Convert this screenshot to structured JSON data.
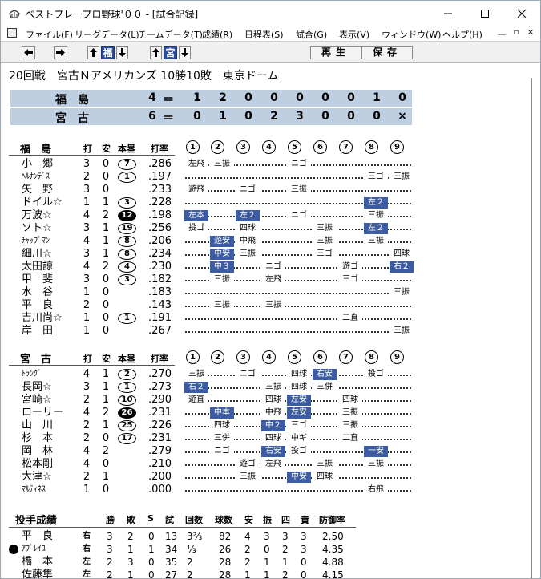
{
  "window": {
    "title": "ベストプレープロ野球'００ - [試合記録]"
  },
  "menu": [
    "ファイル(F)",
    "リーグデータ(L)",
    "チームデータ(T)",
    "成績(R)",
    "日程表(S)",
    "試合(G)",
    "表示(V)",
    "ウィンドウ(W)",
    "ヘルプ(H)"
  ],
  "toolbar": {
    "team1": "福",
    "team2": "宮",
    "play": "再生",
    "save": "保存"
  },
  "game": {
    "title": "20回戦　宮古Ｎアメリカンズ  10勝10敗　東京ドーム"
  },
  "scoreboard": [
    {
      "team": "福　島",
      "runs": "4",
      "eq": "＝",
      "innings": [
        "1",
        "2",
        "0",
        "0",
        "0",
        "0",
        "0",
        "1",
        "0"
      ]
    },
    {
      "team": "宮　古",
      "runs": "6",
      "eq": "＝",
      "innings": [
        "0",
        "1",
        "0",
        "2",
        "3",
        "0",
        "0",
        "0",
        "×"
      ]
    }
  ],
  "headers": {
    "ab": "打",
    "h": "安",
    "hr": "本塁",
    "avg": "打率",
    "innings": [
      "①",
      "②",
      "③",
      "④",
      "⑤",
      "⑥",
      "⑦",
      "⑧",
      "⑨"
    ]
  },
  "chart_data": {
    "type": "table",
    "teams": [
      {
        "name": "福　島",
        "batters": [
          {
            "name": "小　郷",
            "ab": "3",
            "h": "0",
            "hr": "7",
            "avg": ".286",
            "results": [
              [
                1,
                "左飛"
              ],
              [
                2,
                "三振"
              ],
              [
                5,
                "ニゴ"
              ]
            ]
          },
          {
            "name": "ﾍﾙﾅﾝﾃﾞｽ",
            "narrow": true,
            "ab": "2",
            "h": "0",
            "hr": "1",
            "avg": ".197",
            "results": [
              [
                8,
                "三ゴ"
              ],
              [
                9,
                "三振"
              ]
            ]
          },
          {
            "name": "矢　野",
            "ab": "3",
            "h": "0",
            "avg": ".233",
            "results": [
              [
                1,
                "遊飛"
              ],
              [
                3,
                "ニゴ"
              ],
              [
                5,
                "三振"
              ]
            ]
          },
          {
            "name": "ドイル☆",
            "ab": "1",
            "h": "1",
            "hr": "3",
            "avg": ".228",
            "results": [
              [
                8,
                "左２",
                1
              ]
            ]
          },
          {
            "name": "万波☆",
            "ab": "4",
            "h": "2",
            "hr": "12",
            "hrfill": true,
            "avg": ".198",
            "results": [
              [
                1,
                "左本",
                1
              ],
              [
                3,
                "左２",
                1
              ],
              [
                5,
                "ニゴ"
              ],
              [
                8,
                "三振"
              ]
            ]
          },
          {
            "name": "ソト☆",
            "ab": "3",
            "h": "1",
            "hr": "19",
            "avg": ".256",
            "results": [
              [
                1,
                "投ゴ"
              ],
              [
                3,
                "四球"
              ],
              [
                6,
                "三振"
              ],
              [
                8,
                "左２",
                1
              ]
            ]
          },
          {
            "name": "ﾁｬｯﾌﾟﾏﾝ",
            "narrow": true,
            "ab": "4",
            "h": "1",
            "hr": "8",
            "avg": ".206",
            "results": [
              [
                2,
                "遊安",
                1
              ],
              [
                3,
                "中飛"
              ],
              [
                6,
                "三振"
              ],
              [
                8,
                "三振"
              ]
            ]
          },
          {
            "name": "細川☆",
            "ab": "3",
            "h": "1",
            "hr": "8",
            "avg": ".234",
            "results": [
              [
                2,
                "中安",
                1
              ],
              [
                3,
                "三振"
              ],
              [
                6,
                "三ゴ"
              ],
              [
                9,
                "四球"
              ]
            ]
          },
          {
            "name": "太田諒",
            "ab": "4",
            "h": "2",
            "hr": "4",
            "avg": ".230",
            "results": [
              [
                2,
                "中３",
                1
              ],
              [
                4,
                "ニゴ"
              ],
              [
                7,
                "遊ゴ"
              ],
              [
                9,
                "右２",
                1
              ]
            ]
          },
          {
            "name": "甲　斐",
            "ab": "3",
            "h": "0",
            "hr": "3",
            "avg": ".182",
            "results": [
              [
                2,
                "三振"
              ],
              [
                4,
                "左飛"
              ],
              [
                7,
                "三ゴ"
              ]
            ]
          },
          {
            "name": "水　谷",
            "ab": "1",
            "h": "0",
            "avg": ".183",
            "results": [
              [
                9,
                "三振"
              ]
            ]
          },
          {
            "name": "平　良",
            "ab": "2",
            "h": "0",
            "avg": ".143",
            "results": [
              [
                2,
                "三振"
              ],
              [
                4,
                "三振"
              ]
            ]
          },
          {
            "name": "吉川尚☆",
            "ab": "1",
            "h": "0",
            "hr": "1",
            "avg": ".191",
            "results": [
              [
                7,
                "二直"
              ]
            ]
          },
          {
            "name": "岸　田",
            "ab": "1",
            "h": "0",
            "avg": ".267",
            "results": [
              [
                9,
                "三振"
              ]
            ]
          }
        ]
      },
      {
        "name": "宮　古",
        "batters": [
          {
            "name": "ﾄﾗﾝｸﾞ",
            "narrow": true,
            "ab": "4",
            "h": "1",
            "hr": "2",
            "avg": ".270",
            "results": [
              [
                1,
                "三振"
              ],
              [
                3,
                "ニゴ"
              ],
              [
                5,
                "四球"
              ],
              [
                6,
                "右安",
                1
              ],
              [
                8,
                "投ゴ"
              ]
            ]
          },
          {
            "name": "長岡☆",
            "ab": "3",
            "h": "1",
            "hr": "1",
            "avg": ".273",
            "results": [
              [
                1,
                "右２",
                1
              ],
              [
                4,
                "三振"
              ],
              [
                5,
                "四球"
              ],
              [
                6,
                "三併"
              ]
            ]
          },
          {
            "name": "宮崎☆",
            "ab": "2",
            "h": "1",
            "hr": "10",
            "avg": ".290",
            "results": [
              [
                1,
                "遊直"
              ],
              [
                4,
                "四球"
              ],
              [
                5,
                "左安",
                1
              ],
              [
                7,
                "四球"
              ]
            ]
          },
          {
            "name": "ローリー",
            "ab": "4",
            "h": "2",
            "hr": "26",
            "hrfill": true,
            "avg": ".231",
            "results": [
              [
                2,
                "中本",
                1
              ],
              [
                4,
                "中飛"
              ],
              [
                5,
                "左安",
                1
              ],
              [
                7,
                "三振"
              ]
            ]
          },
          {
            "name": "山　川",
            "ab": "2",
            "h": "1",
            "hr": "25",
            "avg": ".226",
            "results": [
              [
                2,
                "四球"
              ],
              [
                4,
                "中２",
                1
              ],
              [
                5,
                "三ゴ"
              ],
              [
                7,
                "三振"
              ]
            ]
          },
          {
            "name": "杉　本",
            "ab": "2",
            "h": "0",
            "hr": "17",
            "avg": ".231",
            "results": [
              [
                2,
                "三併"
              ],
              [
                4,
                "四球"
              ],
              [
                5,
                "中ギ"
              ],
              [
                7,
                "二直"
              ]
            ]
          },
          {
            "name": "岡　林",
            "ab": "4",
            "h": "2",
            "avg": ".279",
            "results": [
              [
                2,
                "ニゴ"
              ],
              [
                4,
                "右安",
                1
              ],
              [
                5,
                "投ゴ"
              ],
              [
                8,
                "一安",
                1
              ]
            ]
          },
          {
            "name": "松本剛",
            "ab": "4",
            "h": "0",
            "avg": ".210",
            "results": [
              [
                3,
                "遊ゴ"
              ],
              [
                4,
                "左飛"
              ],
              [
                6,
                "三振"
              ],
              [
                8,
                "三振"
              ]
            ]
          },
          {
            "name": "大津☆",
            "ab": "2",
            "h": "1",
            "avg": ".200",
            "results": [
              [
                3,
                "三振"
              ],
              [
                5,
                "中安",
                1
              ],
              [
                6,
                "四球"
              ]
            ]
          },
          {
            "name": "ﾏﾙﾃｨﾈｽ",
            "narrow": true,
            "ab": "1",
            "h": "0",
            "avg": ".000",
            "results": [
              [
                8,
                "右飛"
              ]
            ]
          }
        ]
      }
    ]
  },
  "pitching": {
    "title": "投手成績",
    "headers": [
      "勝",
      "敗",
      "S",
      "試",
      "回数",
      "球数",
      "安",
      "振",
      "四",
      "責",
      "防御率"
    ],
    "rows": [
      {
        "name": "平　良",
        "hand": "右",
        "w": "3",
        "l": "2",
        "s": "0",
        "g": "13",
        "ip": "3⅔",
        "np": "82",
        "h": "4",
        "so": "3",
        "bb": "3",
        "er": "3",
        "era": "2.50"
      },
      {
        "name": "ｱﾌﾞﾚｲﾕ",
        "hand": "右",
        "marker": true,
        "w": "3",
        "l": "1",
        "s": "1",
        "g": "34",
        "ip": "⅓",
        "np": "26",
        "h": "2",
        "so": "0",
        "bb": "2",
        "er": "3",
        "era": "4.35"
      },
      {
        "name": "橋　本",
        "hand": "左",
        "w": "2",
        "l": "3",
        "s": "0",
        "g": "35",
        "ip": "2",
        "np": "28",
        "h": "2",
        "so": "1",
        "bb": "1",
        "er": "0",
        "era": "4.88"
      },
      {
        "name": "佐藤隼",
        "hand": "左",
        "w": "2",
        "l": "1",
        "s": "0",
        "g": "27",
        "ip": "2",
        "np": "28",
        "h": "1",
        "so": "1",
        "bb": "2",
        "er": "0",
        "era": "4.15"
      }
    ]
  }
}
